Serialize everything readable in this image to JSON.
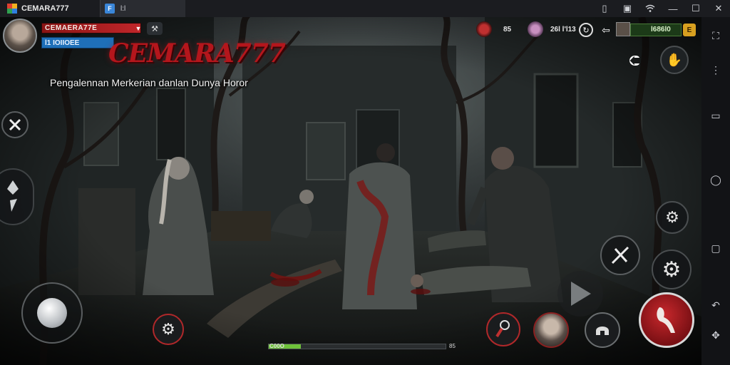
{
  "window": {
    "title": "CEMARA777",
    "tab_label": "l:l"
  },
  "player": {
    "name": "CEMAERA77E",
    "level_label": "l1 IOIIOEE"
  },
  "game": {
    "logo": "CEMARA777",
    "tagline": "Pengalennan Merkerian danlan Dunya Horor"
  },
  "resources": {
    "skull_count": "85",
    "gem_count": "26l l'l13",
    "gold": "l686l0",
    "gold_coin_label": "E"
  },
  "progress": {
    "label": "C00O",
    "end_label": "85",
    "fraction": 0.18
  },
  "icons": {
    "cancel_action": "crossed-swords-icon",
    "left_skill": "feather-blade-icon",
    "settings": "gear-icon",
    "skill_cross": "crossed-blades-icon",
    "play": "play-icon",
    "attack": "claw-strike-icon",
    "inventory": "inventory-tool-icon",
    "hero_portrait": "portrait-icon",
    "helmet": "helmet-icon",
    "record": "record-icon",
    "small_gear": "small-gear-icon",
    "share": "share-icon",
    "hand": "hand-icon"
  },
  "colors": {
    "blood_red": "#b4161c",
    "hp_bar": "#c0262a",
    "level_bar": "#1f6fb8",
    "progress_fill": "#6ec23a",
    "gold": "#d8a020"
  }
}
